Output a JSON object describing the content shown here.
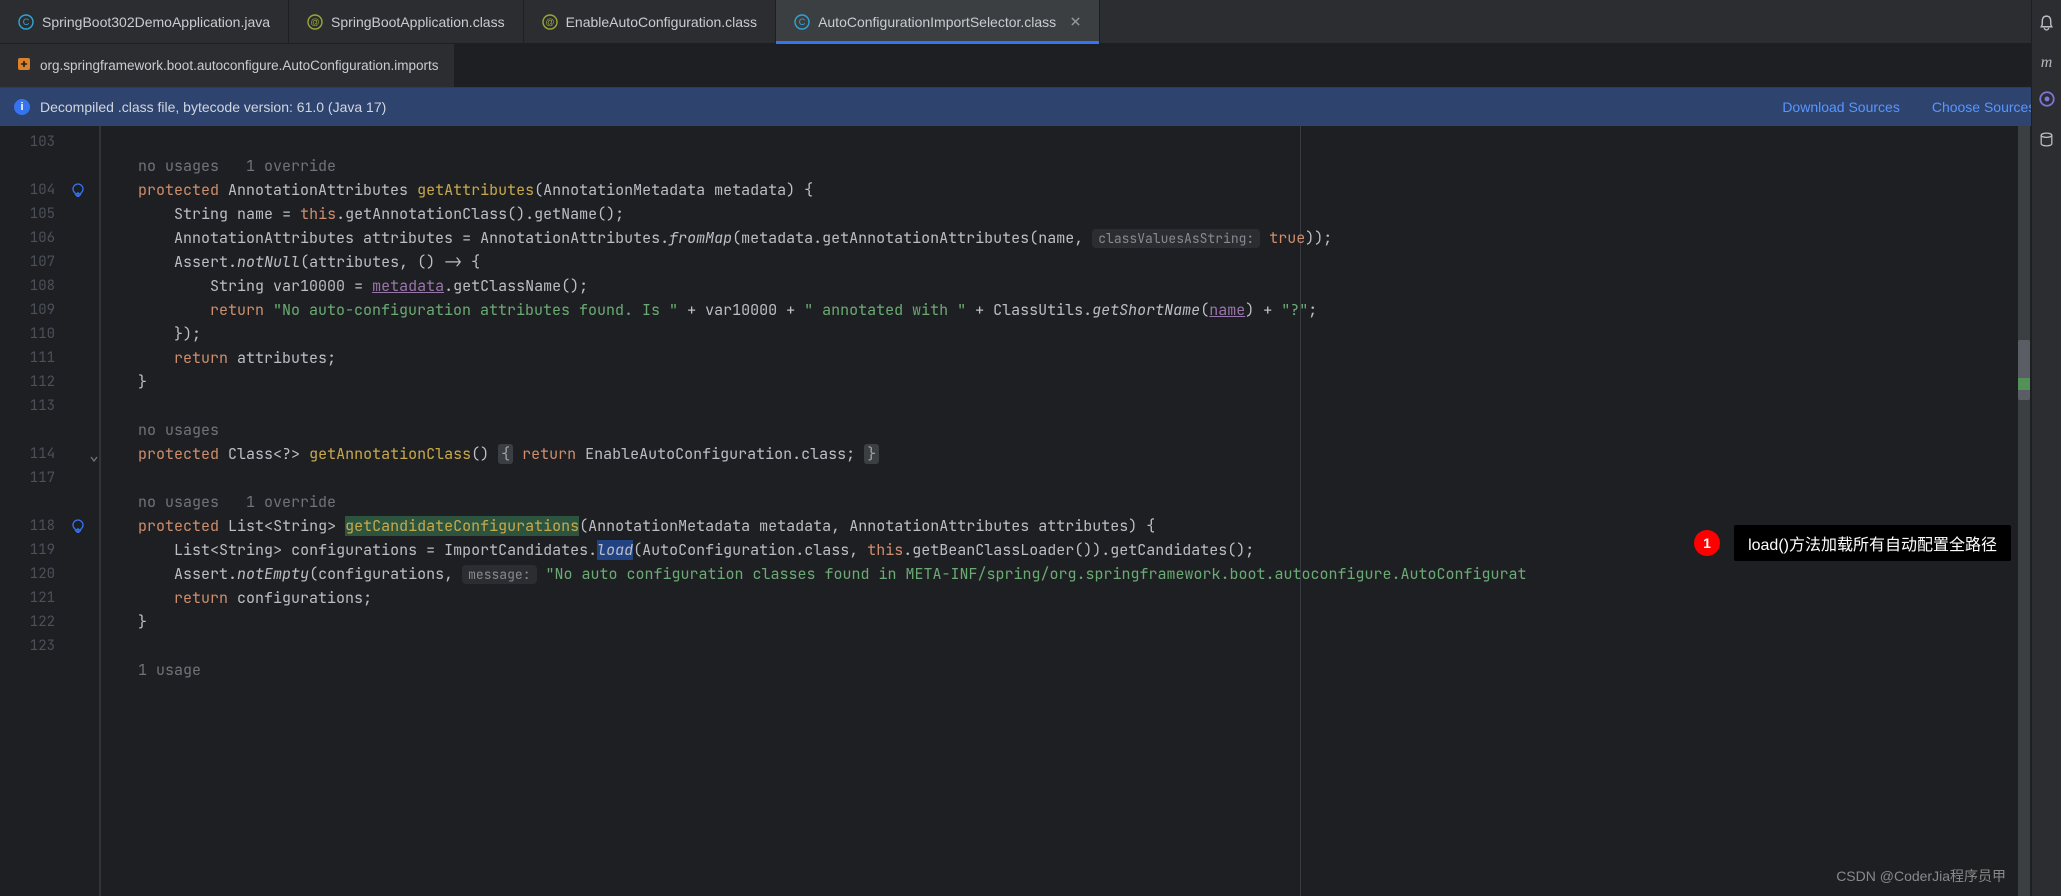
{
  "tabs": [
    {
      "icon": "class-icon",
      "label": "SpringBoot302DemoApplication.java"
    },
    {
      "icon": "annotation-icon",
      "label": "SpringBootApplication.class"
    },
    {
      "icon": "annotation-icon",
      "label": "EnableAutoConfiguration.class"
    },
    {
      "icon": "class-icon",
      "label": "AutoConfigurationImportSelector.class",
      "active": true
    }
  ],
  "secondary_tab": {
    "icon": "imports-icon",
    "label": "org.springframework.boot.autoconfigure.AutoConfiguration.imports"
  },
  "info_bar": {
    "text": "Decompiled .class file, bytecode version: 61.0 (Java 17)",
    "link_download": "Download Sources",
    "link_choose": "Choose Sources..."
  },
  "gutter": {
    "lines": [
      "103",
      "104",
      "105",
      "106",
      "107",
      "108",
      "109",
      "110",
      "111",
      "112",
      "113",
      "114",
      "117",
      "118",
      "119",
      "120",
      "121",
      "122",
      "123"
    ]
  },
  "code": {
    "hint_nousages": "no usages",
    "hint_1override": "1 override",
    "hint_1usage": "1 usage",
    "kw_protected": "protected",
    "kw_return": "return",
    "kw_this": "this",
    "kw_true": "true",
    "type_AnnotationAttributes": "AnnotationAttributes",
    "type_String": "String",
    "type_Assert": "Assert",
    "type_ClassUtils": "ClassUtils",
    "type_List": "List",
    "type_Class": "Class",
    "type_ImportCandidates": "ImportCandidates",
    "type_AnnotationMetadata": "AnnotationMetadata",
    "type_AutoConfiguration": "AutoConfiguration",
    "type_EnableAutoConfiguration": "EnableAutoConfiguration",
    "fn_getAttributes": "getAttributes",
    "fn_getAnnotationClass": "getAnnotationClass",
    "fn_getCandidateConfigurations": "getCandidateConfigurations",
    "fn_getName": "getName",
    "fn_fromMap": "fromMap",
    "fn_getAnnotationAttributes": "getAnnotationAttributes",
    "fn_notNull": "notNull",
    "fn_getClassName": "getClassName",
    "fn_getShortName": "getShortName",
    "fn_load": "load",
    "fn_getBeanClassLoader": "getBeanClassLoader",
    "fn_getCandidates": "getCandidates",
    "fn_notEmpty": "notEmpty",
    "id_metadata": "metadata",
    "id_attributes": "attributes",
    "id_name": "name",
    "id_var10000": "var10000",
    "id_configurations": "configurations",
    "str_noattrs": "\"No auto-configuration attributes found. Is \"",
    "str_annotated": "\" annotated with \"",
    "str_q": "\"?\"",
    "str_noauto": "\"No auto configuration classes found in META-INF/spring/org.springframework.boot.autoconfigure.AutoConfigurat",
    "hint_classValues": "classValuesAsString:",
    "hint_message": "message:",
    "fold_open": "{",
    "fold_close": "}"
  },
  "annotation": {
    "num": "1",
    "text": "load()方法加载所有自动配置全路径"
  },
  "watermark": "CSDN @CoderJia程序员甲"
}
